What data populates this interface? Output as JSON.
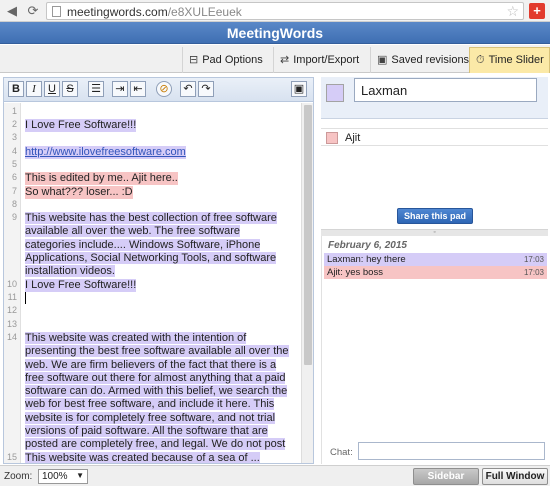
{
  "browser": {
    "url_host": "meetingwords.com",
    "url_path": "/e8XULEeuek",
    "back_icon": "back-arrow-icon",
    "reload_icon": "reload-icon",
    "star_icon": "star-icon",
    "extension_glyph": "+"
  },
  "app": {
    "title": "MeetingWords"
  },
  "tabs": [
    {
      "label": "Pad Options",
      "icon": "⊟"
    },
    {
      "label": "Import/Export",
      "icon": "⇄"
    },
    {
      "label": "Saved revisions",
      "icon": "▣"
    },
    {
      "label": "Time Slider",
      "icon": "⏱"
    }
  ],
  "toolbar": {
    "bold": "B",
    "italic": "I",
    "underline": "U",
    "strike": "S",
    "list": "☰",
    "indent": "⇥",
    "outdent": "⇤",
    "color": "⊘",
    "undo": "↶",
    "redo": "↷",
    "save": "▣"
  },
  "editor": {
    "line_numbers": [
      "1",
      "2",
      "3",
      "4",
      "5",
      "6",
      "7",
      "8",
      "9",
      "10",
      "11",
      "12",
      "13",
      "14",
      "15"
    ],
    "line2": "I Love Free Software!!!",
    "line4": "http://www.ilovefreesoftware.com",
    "line6": " This is edited by me.. Ajit here..",
    "line7": " So what??? loser... :D",
    "para9": "This website has the best collection of free software available all over the web. The free software categories include.... Windows Software, iPhone Applications, Social Networking Tools, and software installation videos.",
    "line11": "I Love Free Software!!!",
    "para14": "This website was created with the intention of presenting the best free software available all over the web. We are firm believers of the fact that there is a free software out there for almost anything that a paid software can do. Armed with this belief, we search the web for best free software, and include it here. This website is for completely free software, and not trial versions of paid software. All the software that are posted are completely free, and legal. We do not post any cracks.",
    "line15": "This website was created because of a sea of ..."
  },
  "users": {
    "me_name": "Laxman",
    "me_color": "#d5ccf7",
    "other_name": "Ajit",
    "other_color": "#f7c4c4"
  },
  "share": {
    "label": "Share this pad"
  },
  "chat": {
    "date": "February 6, 2015",
    "messages": [
      {
        "text": "Laxman: hey there",
        "time": "17:03"
      },
      {
        "text": "Ajit: yes boss",
        "time": "17:03"
      }
    ],
    "input_label": "Chat:"
  },
  "bottom": {
    "zoom_label": "Zoom:",
    "zoom_value": "100%",
    "sidebar_label": "Sidebar",
    "fullwindow_label": "Full Window"
  }
}
